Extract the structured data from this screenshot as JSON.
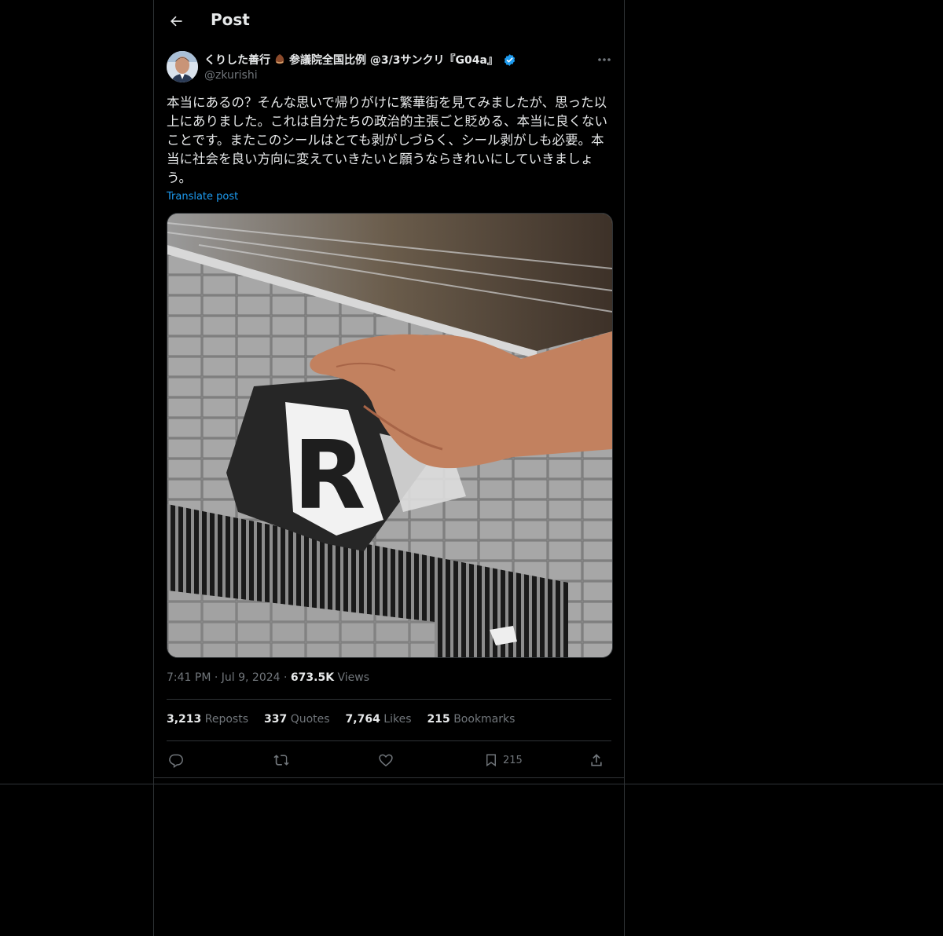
{
  "header": {
    "title": "Post"
  },
  "author": {
    "display_name": "くりした善行",
    "display_name_suffix": "参議院全国比例 @3/3サンクリ『G04a』",
    "handle": "@zkurishi",
    "verified": true
  },
  "post": {
    "text": "本当にあるの？そんな思いで帰りがけに繁華街を見てみましたが、思った以上にありました。これは自分たちの政治的主張ごと貶める、本当に良くないことです。またこのシールはとても剥がしづらく、シール剥がしも必要。本当に社会を良い方向に変えていきたいと願うならきれいにしていきましょう。",
    "translate_label": "Translate post"
  },
  "meta": {
    "time": "7:41 PM",
    "dot1": "·",
    "date": "Jul 9, 2024",
    "dot2": "·",
    "views_count": "673.5K",
    "views_label": "Views"
  },
  "stats": {
    "reposts_count": "3,213",
    "reposts_label": "Reposts",
    "quotes_count": "337",
    "quotes_label": "Quotes",
    "likes_count": "7,764",
    "likes_label": "Likes",
    "bookmarks_count": "215",
    "bookmarks_label": "Bookmarks"
  },
  "actions": {
    "bookmark_count": "215"
  },
  "icons": {
    "back": "arrow-left-icon",
    "more": "more-horizontal-icon",
    "verified": "verified-badge-icon",
    "reply": "reply-icon",
    "repost": "repost-icon",
    "like": "heart-icon",
    "bookmark": "bookmark-icon",
    "share": "share-icon"
  },
  "colors": {
    "background": "#000000",
    "text": "#e7e9ea",
    "muted": "#71767b",
    "accent": "#1d9bf0",
    "border": "#2f3336"
  }
}
